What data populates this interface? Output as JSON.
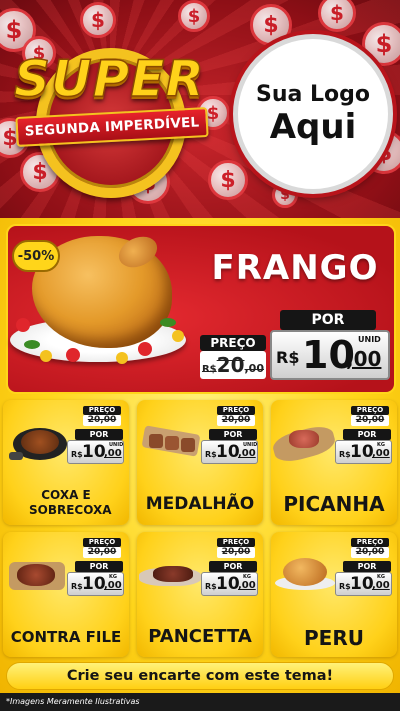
{
  "brand": {
    "title": "SUPER",
    "subtitle": "SEGUNDA IMPERDÍVEL"
  },
  "logo": {
    "line1": "Sua Logo",
    "line2": "Aqui"
  },
  "coin_symbol": "$",
  "featured": {
    "discount": "-50%",
    "name": "FRANGO",
    "preco_label": "PREÇO",
    "old_prefix": "R$",
    "old_int": "20",
    "old_cents": ",00",
    "por_label": "POR",
    "currency": "R$",
    "new_int": "10",
    "new_cents": ",00",
    "unit": "UNID"
  },
  "products": [
    {
      "name": "COXA E SOBRECOXA",
      "preco_label": "PREÇO",
      "old_price": "20,00",
      "por_label": "POR",
      "currency": "R$",
      "new_int": "10",
      "new_cents": ",00",
      "unit": "UNID",
      "icon": "roasted-leg-icon"
    },
    {
      "name": "MEDALHÃO",
      "preco_label": "PREÇO",
      "old_price": "20,00",
      "por_label": "POR",
      "currency": "R$",
      "new_int": "10",
      "new_cents": ",00",
      "unit": "UNID",
      "icon": "skewers-icon"
    },
    {
      "name": "PICANHA",
      "preco_label": "PREÇO",
      "old_price": "20,00",
      "por_label": "POR",
      "currency": "R$",
      "new_int": "10",
      "new_cents": ",00",
      "unit": "KG",
      "icon": "picanha-board-icon"
    },
    {
      "name": "CONTRA FILE",
      "preco_label": "PREÇO",
      "old_price": "20,00",
      "por_label": "POR",
      "currency": "R$",
      "new_int": "10",
      "new_cents": ",00",
      "unit": "KG",
      "icon": "steak-icon"
    },
    {
      "name": "PANCETTA",
      "preco_label": "PREÇO",
      "old_price": "20,00",
      "por_label": "POR",
      "currency": "R$",
      "new_int": "10",
      "new_cents": ",00",
      "unit": "KG",
      "icon": "pancetta-icon"
    },
    {
      "name": "PERU",
      "preco_label": "PREÇO",
      "old_price": "20,00",
      "por_label": "POR",
      "currency": "R$",
      "new_int": "10",
      "new_cents": ",00",
      "unit": "KG",
      "icon": "roast-turkey-icon"
    }
  ],
  "cta": "Crie seu encarte com este tema!",
  "footer": "*Imagens Meramente Ilustrativas",
  "colors": {
    "header_red": "#c8252b",
    "body_yellow": "#ffd51a",
    "gold": "#f4c21f",
    "dark": "#151515"
  }
}
